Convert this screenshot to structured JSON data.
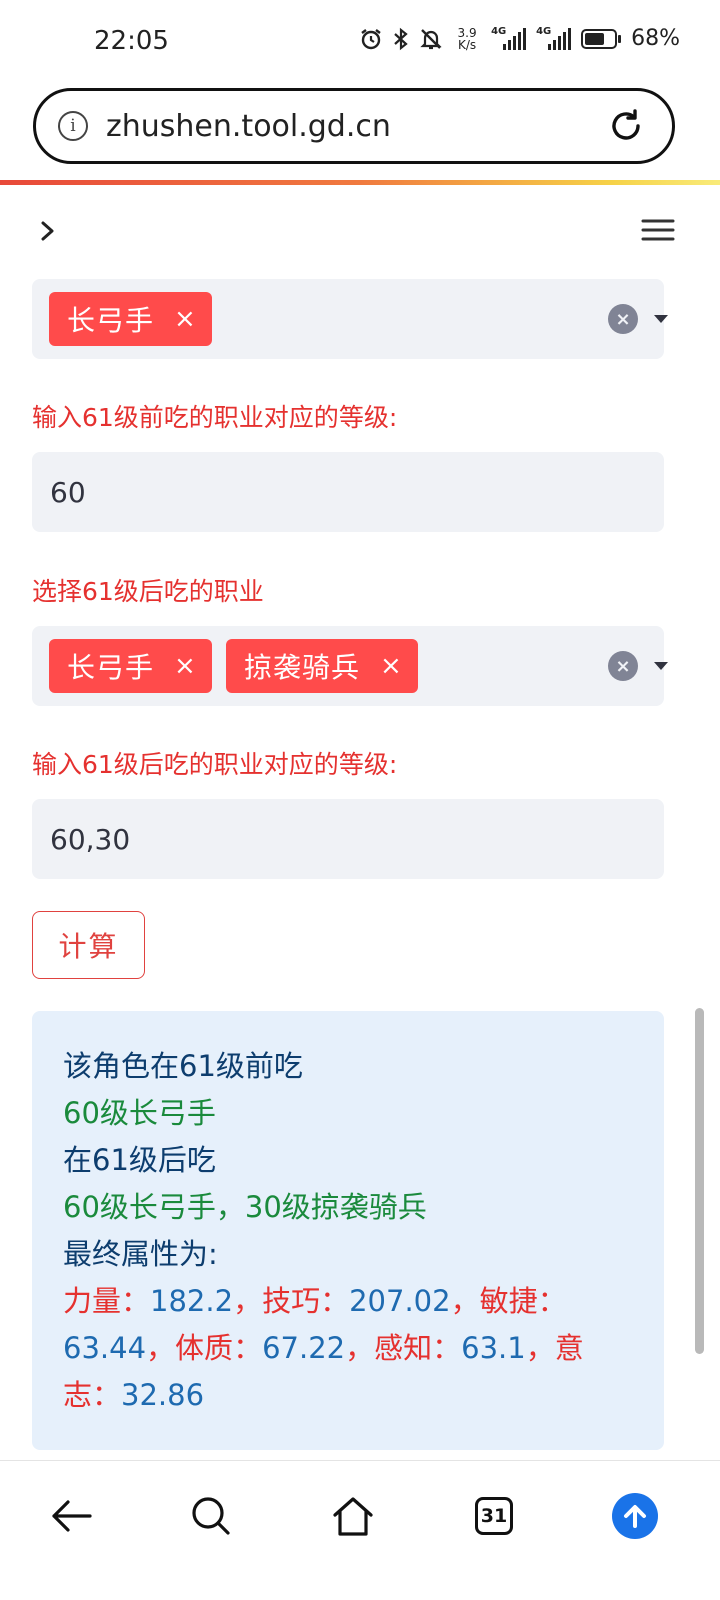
{
  "status": {
    "time": "22:05",
    "net_speed_value": "3.9",
    "net_speed_unit": "K/s",
    "signal1_label": "4G",
    "signal2_label": "4G",
    "battery_percent": "68%",
    "battery_level": 0.68
  },
  "browser": {
    "url": "zhushen.tool.gd.cn",
    "info_glyph": "i",
    "tabs_count": "31"
  },
  "form": {
    "before_classes": [
      {
        "label": "长弓手",
        "remove": "×"
      }
    ],
    "before_level_label": "输入61级前吃的职业对应的等级:",
    "before_level_value": "60",
    "after_classes_label": "选择61级后吃的职业",
    "after_classes": [
      {
        "label": "长弓手",
        "remove": "×"
      },
      {
        "label": "掠袭骑兵",
        "remove": "×"
      }
    ],
    "after_level_label": "输入61级后吃的职业对应的等级:",
    "after_level_value": "60,30",
    "clear_glyph": "×",
    "calculate_label": "计算"
  },
  "result": {
    "line1": "该角色在61级前吃",
    "line2": "60级长弓手",
    "line3": "在61级后吃",
    "line4": "60级长弓手，30级掠袭骑兵",
    "line5": "最终属性为:",
    "stats": [
      {
        "name": "力量",
        "sep": "：",
        "value": "182.2",
        "end": "，"
      },
      {
        "name": "技巧",
        "sep": "：",
        "value": "207.02",
        "end": "，"
      },
      {
        "name": "敏捷",
        "sep": "：",
        "value": "63.44",
        "end": "，"
      },
      {
        "name": "体质",
        "sep": "：",
        "value": "67.22",
        "end": "，"
      },
      {
        "name": "感知",
        "sep": "：",
        "value": "63.1",
        "end": "，"
      },
      {
        "name": "意志",
        "sep": "：",
        "value": "32.86",
        "end": ""
      }
    ]
  },
  "colors": {
    "chip": "#ff4b4b",
    "label_red": "#e5312f",
    "result_bg": "#e6f0fb",
    "result_green": "#1a8a3c",
    "result_navy": "#0d3d6e",
    "result_blue": "#1e6ab0",
    "nav_upload": "#1a73e8"
  },
  "icons": {
    "status": [
      "alarm-icon",
      "bluetooth-icon",
      "mute-icon",
      "signal-icon",
      "battery-icon"
    ],
    "url_bar": [
      "info-icon",
      "reload-icon"
    ],
    "page": [
      "chevron-right-icon",
      "hamburger-menu-icon"
    ],
    "nav": [
      "back-arrow-icon",
      "search-icon",
      "home-icon",
      "tabs-icon",
      "upload-icon"
    ]
  }
}
